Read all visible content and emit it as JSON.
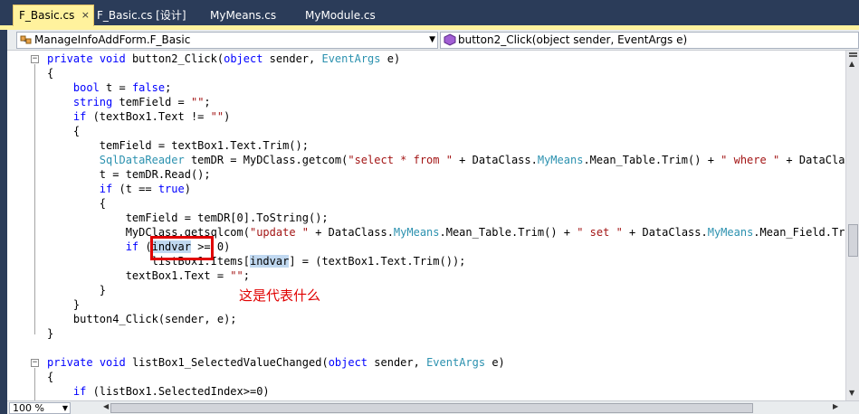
{
  "tabs": [
    {
      "label": "F_Basic.cs",
      "active": true
    },
    {
      "label": "F_Basic.cs [设计]",
      "active": false
    },
    {
      "label": "MyMeans.cs",
      "active": false
    },
    {
      "label": "MyModule.cs",
      "active": false
    }
  ],
  "tab_close_glyph": "×",
  "navbar": {
    "class_combo": "ManageInfoAddForm.F_Basic",
    "member_combo": "button2_Click(object sender, EventArgs e)"
  },
  "code": {
    "l1a": "private",
    "l1b": " ",
    "l1c": "void",
    "l1d": " button2_Click(",
    "l1e": "object",
    "l1f": " sender, ",
    "l1g": "EventArgs",
    "l1h": " e)",
    "l2": "{",
    "l3a": "    ",
    "l3b": "bool",
    "l3c": " t = ",
    "l3d": "false",
    "l3e": ";",
    "l4a": "    ",
    "l4b": "string",
    "l4c": " temField = ",
    "l4d": "\"\"",
    "l4e": ";",
    "l5a": "    ",
    "l5b": "if",
    "l5c": " (textBox1.Text != ",
    "l5d": "\"\"",
    "l5e": ")",
    "l6": "    {",
    "l7": "        temField = textBox1.Text.Trim();",
    "l8a": "        ",
    "l8b": "SqlDataReader",
    "l8c": " temDR = MyDClass.getcom(",
    "l8d": "\"select * from \"",
    "l8e": " + DataClass.",
    "l8f": "MyMeans",
    "l8g": ".Mean_Table.Trim() + ",
    "l8h": "\" where \"",
    "l8i": " + DataClass.M",
    "l9": "        t = temDR.Read();",
    "l10a": "        ",
    "l10b": "if",
    "l10c": " (t == ",
    "l10d": "true",
    "l10e": ")",
    "l11": "        {",
    "l12": "            temField = temDR[0].ToString();",
    "l13a": "            MyDClass.getsqlcom(",
    "l13b": "\"update \"",
    "l13c": " + DataClass.",
    "l13d": "MyMeans",
    "l13e": ".Mean_Table.Trim() + ",
    "l13f": "\" set \"",
    "l13g": " + DataClass.",
    "l13h": "MyMeans",
    "l13i": ".Mean_Field.Trim()",
    "l14a": "            ",
    "l14b": "if",
    "l14c": " (",
    "l14d": "indvar",
    "l14e": " >= 0)",
    "l15a": "                listBox1.Items[",
    "l15b": "indvar",
    "l15c": "] = (textBox1.Text.Trim());",
    "l16a": "            textBox1.Text = ",
    "l16b": "\"\"",
    "l16c": ";",
    "l17": "        }",
    "l18": "    }",
    "l19": "    button4_Click(sender, e);",
    "l20": "}",
    "l21a": "private",
    "l21b": " ",
    "l21c": "void",
    "l21d": " listBox1_SelectedValueChanged(",
    "l21e": "object",
    "l21f": " sender, ",
    "l21g": "EventArgs",
    "l21h": " e)",
    "l22": "{",
    "l23a": "    ",
    "l23b": "if",
    "l23c": " (listBox1.SelectedIndex>=0)"
  },
  "annotation": "这是代表什么",
  "zoom": "100 %",
  "colors": {
    "keyword": "#0000ff",
    "type": "#2b91af",
    "string": "#a31515",
    "annotation": "#e00000",
    "active_tab": "#fff29d",
    "chrome": "#2b3c59"
  },
  "icons": [
    "class-icon",
    "method-icon",
    "dropdown-arrow-icon",
    "collapse-icon",
    "scroll-up-icon",
    "scroll-down-icon",
    "scroll-left-icon",
    "scroll-right-icon"
  ]
}
